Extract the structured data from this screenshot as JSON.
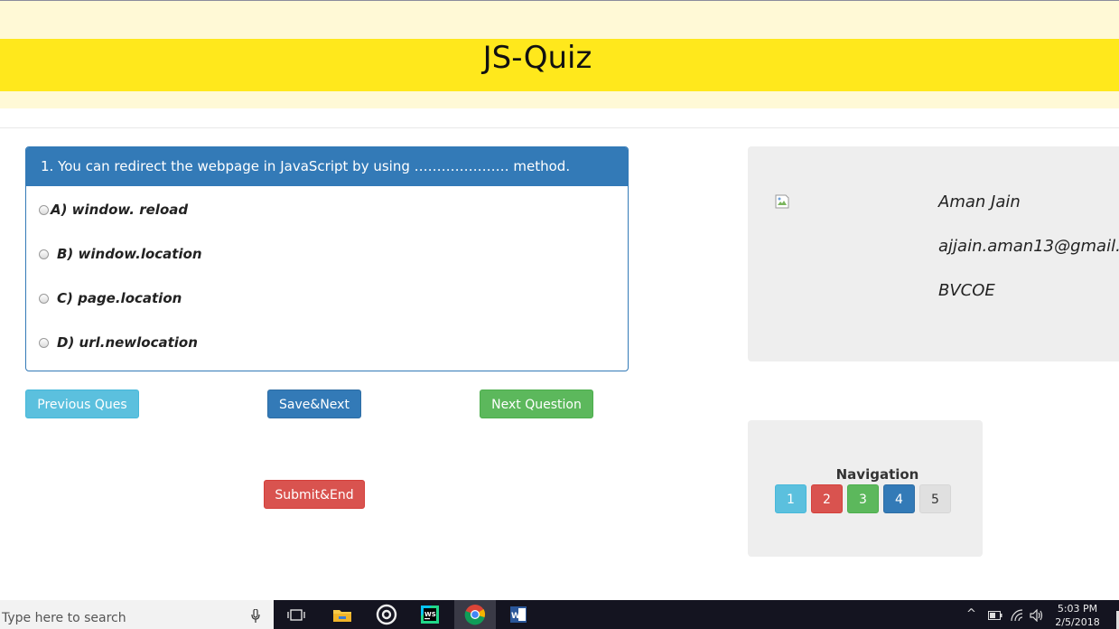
{
  "header": {
    "title": "JS-Quiz"
  },
  "question": {
    "text": "1. You can redirect the webpage in JavaScript by using ………………… method.",
    "options": [
      {
        "label": "A) window. reload"
      },
      {
        "label": "B) window.location"
      },
      {
        "label": "C) page.location"
      },
      {
        "label": "D) url.newlocation"
      }
    ]
  },
  "buttons": {
    "previous": "Previous Ques",
    "save_next": "Save&Next",
    "next": "Next Question",
    "submit_end": "Submit&End"
  },
  "profile": {
    "name": "Aman Jain",
    "email": "ajjain.aman13@gmail.",
    "college": "BVCOE"
  },
  "navigation": {
    "title": "Navigation",
    "items": [
      {
        "label": "1",
        "color": "#5bc0de"
      },
      {
        "label": "2",
        "color": "#d9534f"
      },
      {
        "label": "3",
        "color": "#5cb85c"
      },
      {
        "label": "4",
        "color": "#337ab7"
      },
      {
        "label": "5",
        "color": "#e0e0e0"
      }
    ]
  },
  "taskbar": {
    "search_placeholder": "Type here to search",
    "time": "5:03 PM",
    "date": "2/5/2018",
    "icons": [
      "microphone-icon",
      "task-view-icon",
      "file-explorer-icon",
      "groove-music-icon",
      "webstorm-icon",
      "chrome-icon",
      "word-icon"
    ]
  }
}
